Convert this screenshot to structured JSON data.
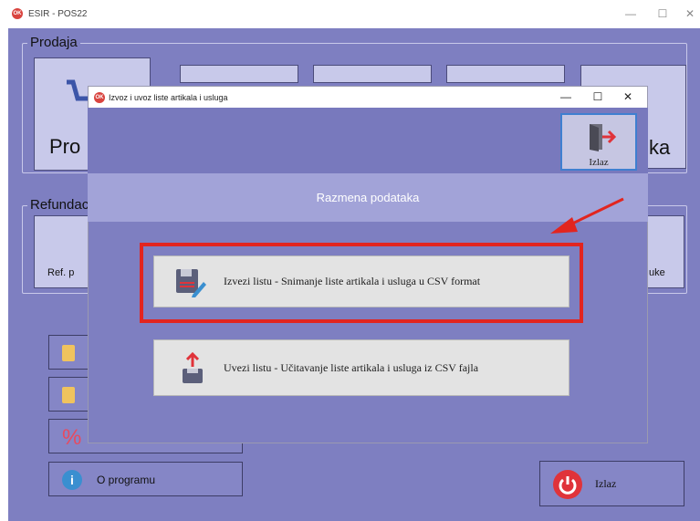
{
  "main_window": {
    "title": "ESIR - POS22",
    "icon_text": "OK",
    "minimize": "—",
    "maximize": "☐",
    "close": "✕"
  },
  "prodaja": {
    "label": "Prodaja",
    "tile_left_text": "Pro",
    "tile_right_text": "ka"
  },
  "refundacija": {
    "label": "Refundac",
    "left_text": "Ref. p",
    "right_text": "uke"
  },
  "bottom": {
    "about_label": "O programu",
    "exit_label": "Izlaz",
    "percent_glyph": "%"
  },
  "dialog": {
    "title": "Izvoz i uvoz liste artikala i usluga",
    "minimize": "—",
    "maximize": "☐",
    "close": "✕",
    "exit_label": "Izlaz",
    "section_title": "Razmena podataka",
    "export_label": "Izvezi listu - Snimanje liste artikala i usluga u CSV format",
    "import_label": "Uvezi listu - Učitavanje liste artikala i usluga iz CSV fajla"
  },
  "colors": {
    "window_bg": "#7e7fc1",
    "tile_bg": "#c8c9ea",
    "highlight": "#e2251f",
    "exit_red": "#e0333a"
  }
}
